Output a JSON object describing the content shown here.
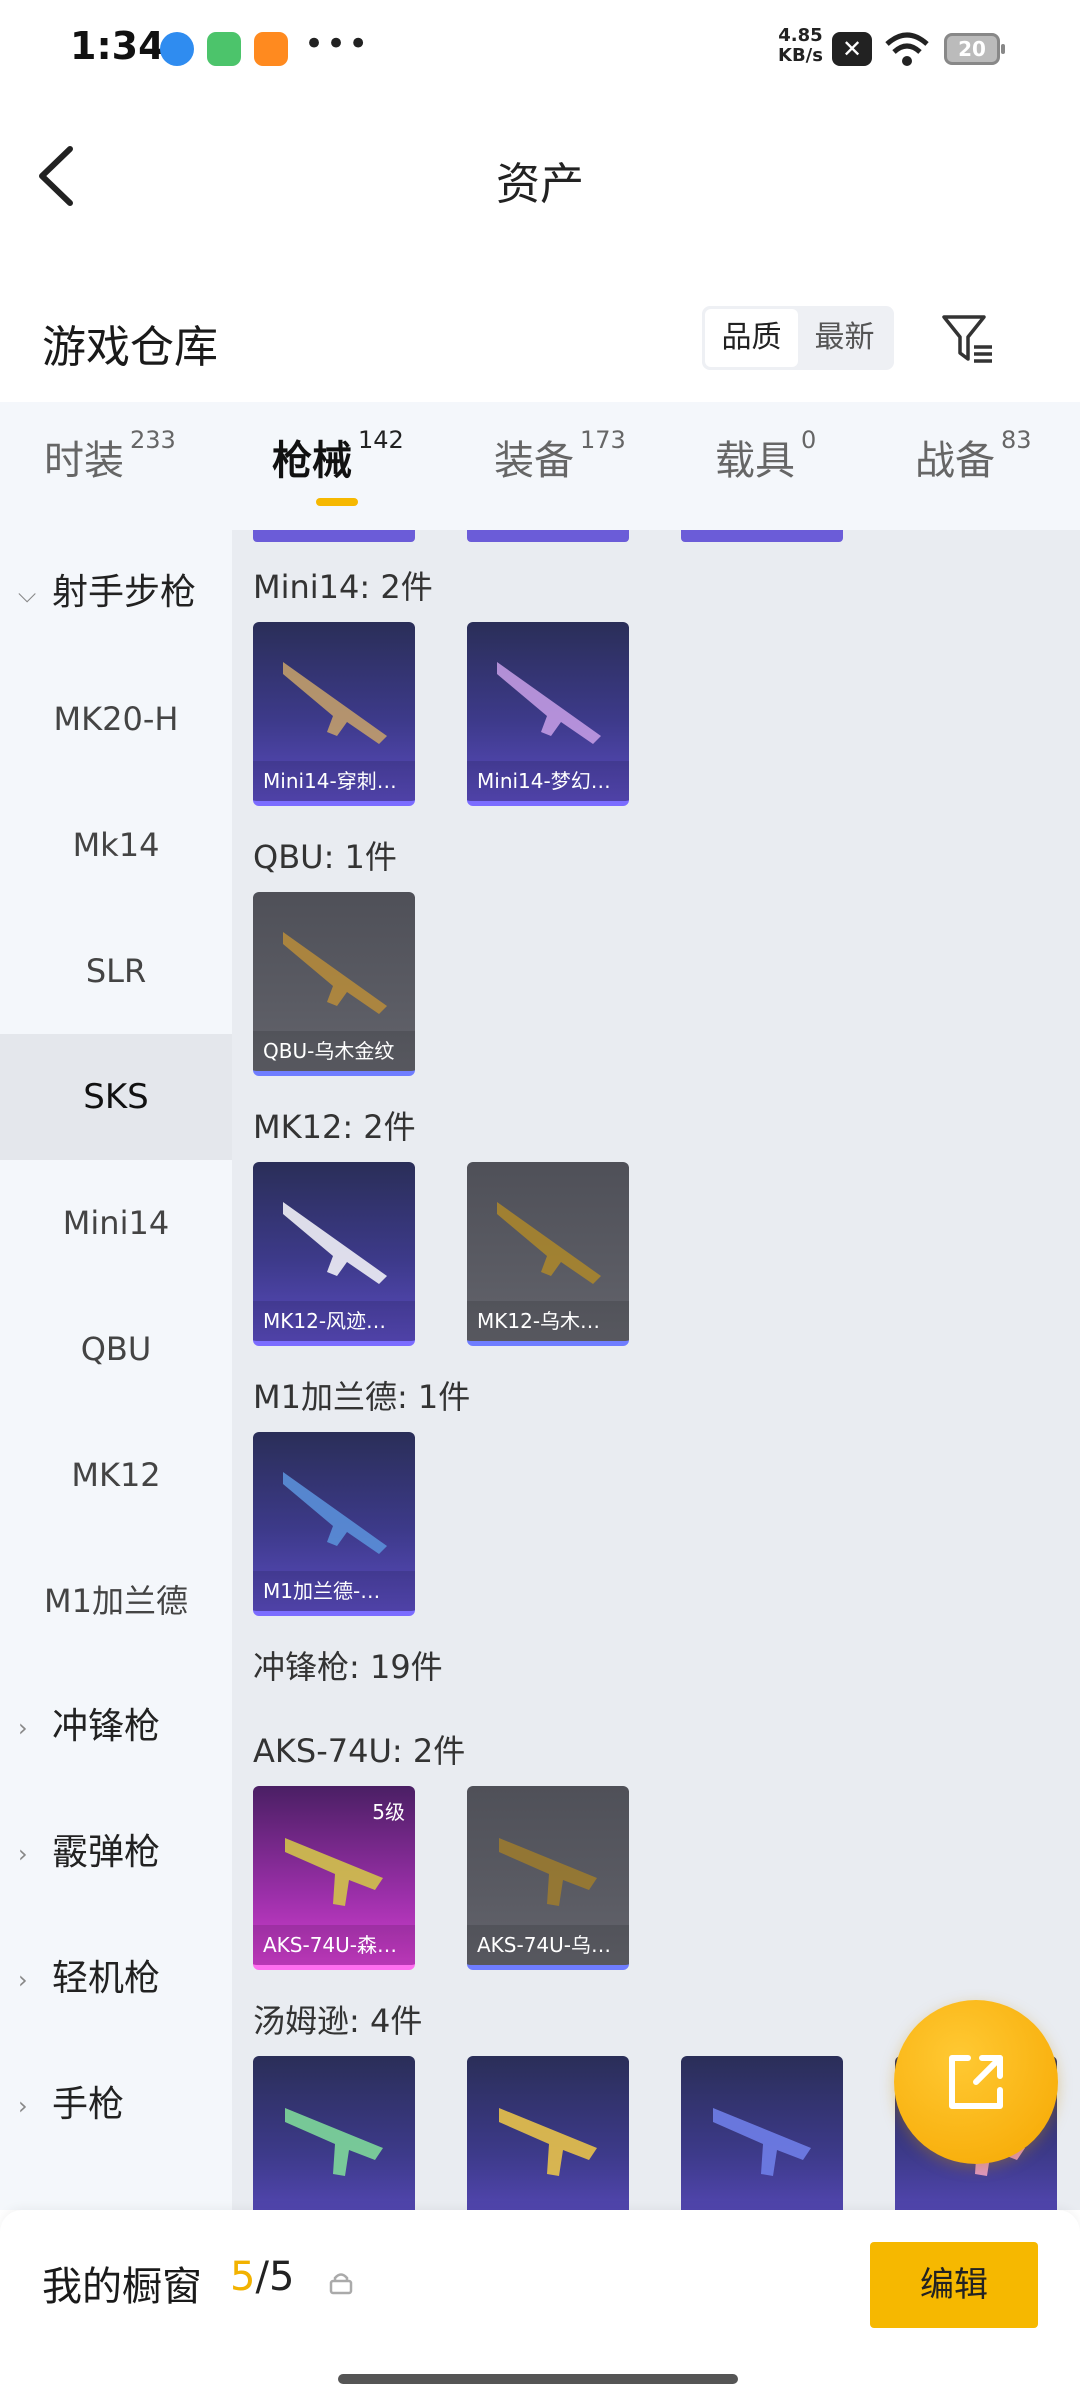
{
  "status_bar": {
    "time": "1:34",
    "dots": "•••",
    "speed_value": "4.85",
    "speed_unit": "KB/s",
    "x_icon": "✕",
    "battery": "20"
  },
  "nav": {
    "title": "资产",
    "back_icon": "chevron-left-icon"
  },
  "section": {
    "title": "游戏仓库",
    "sort_options": [
      "品质",
      "最新"
    ],
    "sort_active": "品质",
    "filter_icon": "filter-icon"
  },
  "tabs": [
    {
      "label": "时装",
      "count": "233"
    },
    {
      "label": "枪械",
      "count": "142",
      "active": true
    },
    {
      "label": "装备",
      "count": "173"
    },
    {
      "label": "载具",
      "count": "0"
    },
    {
      "label": "战备",
      "count": "83"
    }
  ],
  "sidebar": {
    "group_expanded": "射手步枪",
    "items": [
      "MK20-H",
      "Mk14",
      "SLR",
      "SKS",
      "Mini14",
      "QBU",
      "MK12",
      "M1加兰德"
    ],
    "active_item": "SKS",
    "groups_collapsed": [
      "冲锋枪",
      "霰弹枪",
      "轻机枪",
      "手枪"
    ]
  },
  "content": {
    "groups": [
      {
        "label": "Mini14: 2件",
        "cards": [
          {
            "name": "Mini14-穿刺…",
            "style": "purple"
          },
          {
            "name": "Mini14-梦幻…",
            "style": "purple"
          }
        ]
      },
      {
        "label": "QBU: 1件",
        "cards": [
          {
            "name": "QBU-乌木金纹",
            "style": "gray"
          }
        ]
      },
      {
        "label": "MK12: 2件",
        "cards": [
          {
            "name": "MK12-风迹…",
            "style": "purple"
          },
          {
            "name": "MK12-乌木…",
            "style": "gray"
          }
        ]
      },
      {
        "label": "M1加兰德: 1件",
        "cards": [
          {
            "name": "M1加兰德-…",
            "style": "purple"
          }
        ]
      },
      {
        "label": "冲锋枪: 19件",
        "cards": []
      },
      {
        "label": "AKS-74U: 2件",
        "cards": [
          {
            "name": "AKS-74U-森…",
            "style": "magenta",
            "level": "5级"
          },
          {
            "name": "AKS-74U-乌…",
            "style": "gray"
          }
        ]
      },
      {
        "label": "汤姆逊: 4件",
        "cards": [
          {
            "name": "",
            "style": "purple"
          },
          {
            "name": "",
            "style": "purple"
          },
          {
            "name": "",
            "style": "purple"
          },
          {
            "name": "",
            "style": "purple"
          }
        ]
      }
    ]
  },
  "fab": {
    "icon": "external-link-icon"
  },
  "bottom_bar": {
    "label": "我的橱窗",
    "count_current": "5",
    "count_sep": "/",
    "count_total": "5",
    "lock_icon": "lock-icon",
    "edit_label": "编辑"
  },
  "colors": {
    "accent": "#f6b800",
    "sidebar_bg": "#f4f7fb",
    "content_bg": "#e9ecf1"
  }
}
